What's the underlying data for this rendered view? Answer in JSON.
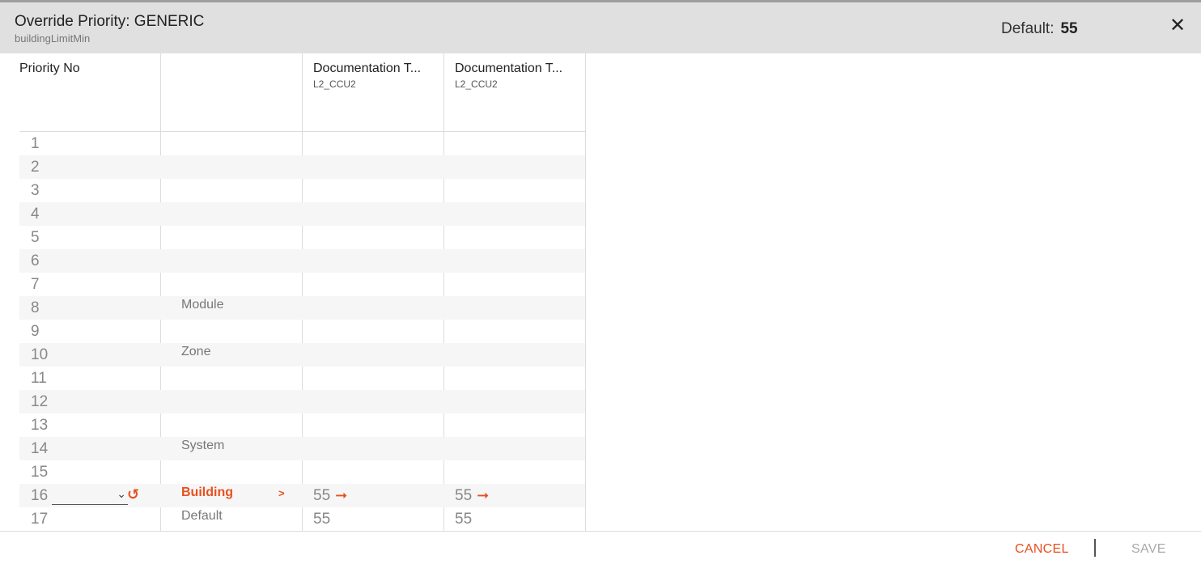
{
  "dialog": {
    "title": "Override Priority: GENERIC",
    "subtitle": "buildingLimitMin",
    "default_label": "Default:",
    "default_value": "55"
  },
  "table": {
    "priority_header": "Priority No",
    "columns": [
      {
        "name": "Documentation T...",
        "sub": "L2_CCU2"
      },
      {
        "name": "Documentation T...",
        "sub": "L2_CCU2"
      }
    ],
    "rows": [
      {
        "num": "1",
        "level": "",
        "v1": "",
        "v2": ""
      },
      {
        "num": "2",
        "level": "",
        "v1": "",
        "v2": ""
      },
      {
        "num": "3",
        "level": "",
        "v1": "",
        "v2": ""
      },
      {
        "num": "4",
        "level": "",
        "v1": "",
        "v2": ""
      },
      {
        "num": "5",
        "level": "",
        "v1": "",
        "v2": ""
      },
      {
        "num": "6",
        "level": "",
        "v1": "",
        "v2": ""
      },
      {
        "num": "7",
        "level": "",
        "v1": "",
        "v2": ""
      },
      {
        "num": "8",
        "level": "Module",
        "v1": "",
        "v2": ""
      },
      {
        "num": "9",
        "level": "",
        "v1": "",
        "v2": ""
      },
      {
        "num": "10",
        "level": "Zone",
        "v1": "",
        "v2": ""
      },
      {
        "num": "11",
        "level": "",
        "v1": "",
        "v2": ""
      },
      {
        "num": "12",
        "level": "",
        "v1": "",
        "v2": ""
      },
      {
        "num": "13",
        "level": "",
        "v1": "",
        "v2": ""
      },
      {
        "num": "14",
        "level": "System",
        "v1": "",
        "v2": ""
      },
      {
        "num": "15",
        "level": "",
        "v1": "",
        "v2": ""
      },
      {
        "num": "16",
        "level": "Building",
        "v1": "55",
        "v2": "55",
        "caret": ">"
      },
      {
        "num": "17",
        "level": "Default",
        "v1": "55",
        "v2": "55"
      }
    ]
  },
  "footer": {
    "cancel": "CANCEL",
    "save": "SAVE"
  },
  "icons": {
    "close": "close-icon",
    "chevron": "chevron-down-icon",
    "reset": "reset-icon",
    "arrow": "arrow-right-icon"
  },
  "colors": {
    "accent": "#e8501f",
    "header_bg": "#e0e0e0"
  }
}
